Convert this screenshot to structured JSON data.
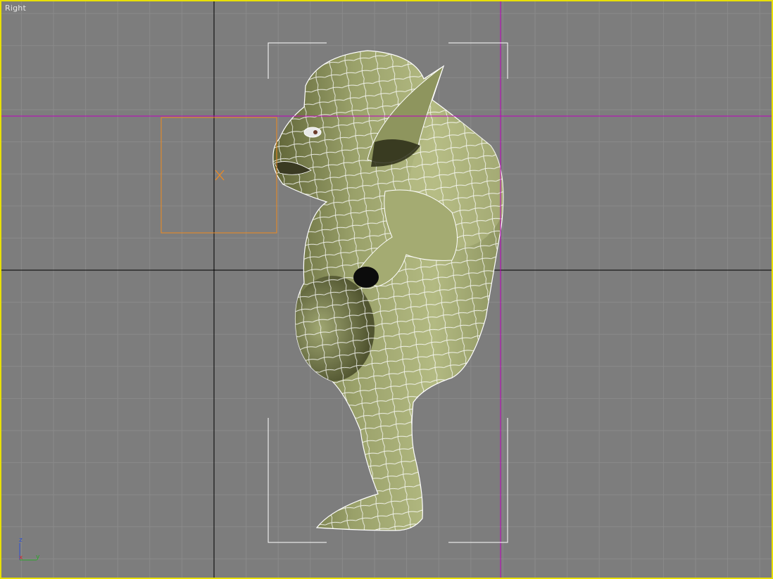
{
  "viewport": {
    "label": "Right",
    "active_border_color": "#e8e000",
    "background_color": "#7d7d7d"
  },
  "grid": {
    "minor_color": "#8a8a8a",
    "major_color": "#000000"
  },
  "guides": {
    "color": "#c000c0"
  },
  "selection": {
    "bracket_color": "#ffffff"
  },
  "helper": {
    "color": "#f08a1e",
    "icon": "x-marker-icon"
  },
  "model": {
    "fill_color": "#a6ad72",
    "wire_color": "#ffffff"
  },
  "axis_tripod": {
    "z_label": "z",
    "x_label": "x",
    "y_label": "y",
    "z_color": "#2a4fd6",
    "x_color": "#d62a2a",
    "y_color": "#2aa82a"
  }
}
